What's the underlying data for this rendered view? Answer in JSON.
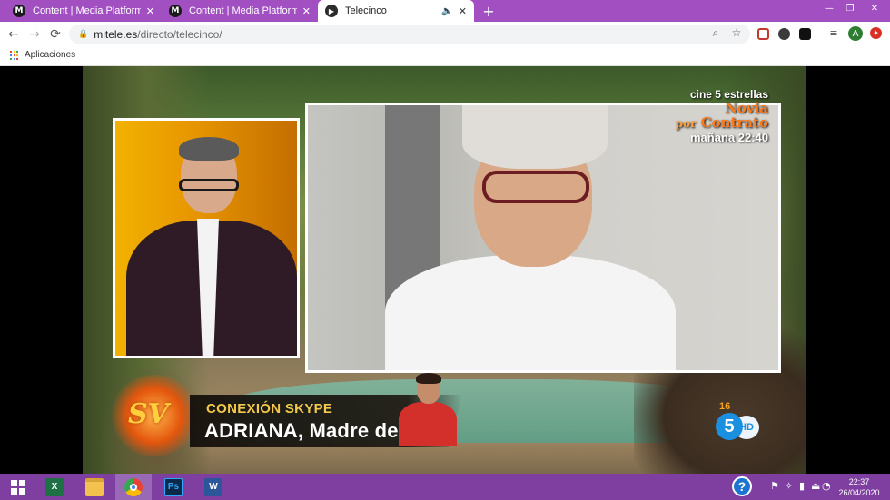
{
  "browser": {
    "tabs": [
      {
        "title": "Content | Media Platform",
        "favicon": "M",
        "active": false
      },
      {
        "title": "Content | Media Platform",
        "favicon": "M",
        "active": false
      },
      {
        "title": "Telecinco",
        "favicon": "▶",
        "active": true
      }
    ],
    "tab_close_glyph": "✕",
    "new_tab_glyph": "+",
    "window_controls": {
      "minimize": "—",
      "restore": "❐",
      "close": "✕"
    },
    "nav": {
      "back": "←",
      "forward": "→",
      "reload": "⟳"
    },
    "address": {
      "domain": "mitele.es",
      "path": "/directo/telecinco/"
    },
    "profile_initial": "A",
    "bookmarks": {
      "apps_label": "Aplicaciones"
    },
    "accent_color": "#a24fc2"
  },
  "video": {
    "promo": {
      "line1": "cine 5 estrellas",
      "title_word1": "Novia",
      "title_word2": "por",
      "title_word3": "Contrato",
      "time": "mañana 22:40"
    },
    "lower_third": {
      "show_logo_text": "SV",
      "line1": "CONEXIÓN SKYPE",
      "line2": "ADRIANA, Madre de Hugo"
    },
    "channel": {
      "age_rating": "16",
      "number": "5",
      "quality": "HD"
    }
  },
  "taskbar": {
    "apps": [
      {
        "name": "excel",
        "label": "X",
        "color": "#1e7145"
      },
      {
        "name": "file-explorer",
        "label": "",
        "color": "#f2c14e"
      },
      {
        "name": "chrome",
        "label": "",
        "color": "#4285f4",
        "active": true
      },
      {
        "name": "photoshop",
        "label": "Ps",
        "color": "#0b2a4a"
      },
      {
        "name": "word",
        "label": "W",
        "color": "#2b579a"
      }
    ],
    "help_glyph": "?",
    "clock": {
      "time": "22:37",
      "date": "26/04/2020"
    }
  }
}
